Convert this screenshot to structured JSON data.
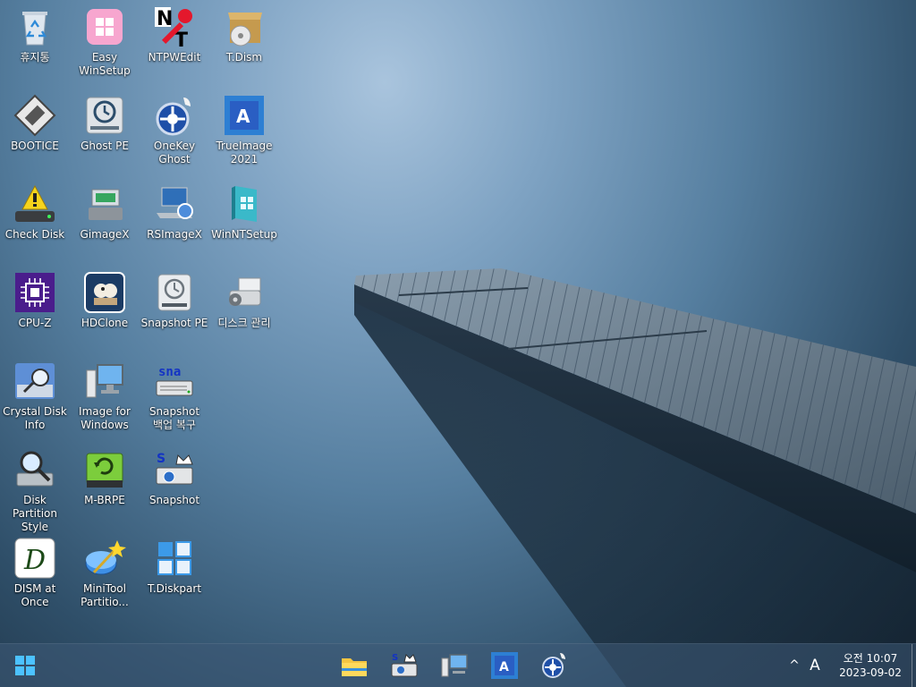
{
  "desktop_icons": [
    {
      "label": "휴지통",
      "icon": "recycle-bin-icon"
    },
    {
      "label": "Easy\nWinSetup",
      "icon": "easy-winsetup-icon"
    },
    {
      "label": "NTPWEdit",
      "icon": "ntpwedit-icon"
    },
    {
      "label": "T.Dism",
      "icon": "tdism-icon"
    },
    {
      "label": "BOOTICE",
      "icon": "bootice-icon"
    },
    {
      "label": "Ghost PE",
      "icon": "ghost-pe-icon"
    },
    {
      "label": "OneKey\nGhost",
      "icon": "onekey-ghost-icon"
    },
    {
      "label": "TrueImage\n2021",
      "icon": "trueimage-icon"
    },
    {
      "label": "Check Disk",
      "icon": "check-disk-icon"
    },
    {
      "label": "GimageX",
      "icon": "gimagex-icon"
    },
    {
      "label": "RSImageX",
      "icon": "rsimagex-icon"
    },
    {
      "label": "WinNTSetup",
      "icon": "winntsetup-icon"
    },
    {
      "label": "CPU-Z",
      "icon": "cpu-z-icon"
    },
    {
      "label": "HDClone",
      "icon": "hdclone-icon"
    },
    {
      "label": "Snapshot PE",
      "icon": "snapshot-pe-icon"
    },
    {
      "label": "디스크 관리",
      "icon": "disk-management-icon"
    },
    {
      "label": "Crystal Disk\nInfo",
      "icon": "crystal-disk-info-icon"
    },
    {
      "label": "Image for\nWindows",
      "icon": "image-for-windows-icon"
    },
    {
      "label": "Snapshot\n백업 복구",
      "icon": "snapshot-restore-icon"
    },
    {
      "label": "Disk Partition\nStyle",
      "icon": "disk-partition-style-icon"
    },
    {
      "label": "M-BRPE",
      "icon": "m-brpe-icon"
    },
    {
      "label": "Snapshot",
      "icon": "snapshot-icon"
    },
    {
      "label": "DISM at\nOnce",
      "icon": "dism-at-once-icon"
    },
    {
      "label": "MiniTool\nPartitio...",
      "icon": "minitool-partition-icon"
    },
    {
      "label": "T.Diskpart",
      "icon": "tdiskpart-icon"
    }
  ],
  "taskbar": {
    "start_icon": "windows-logo-icon",
    "pinned": [
      {
        "icon": "file-explorer-icon"
      },
      {
        "icon": "snapshot-icon"
      },
      {
        "icon": "image-for-windows-icon"
      },
      {
        "icon": "trueimage-icon"
      },
      {
        "icon": "onekey-ghost-icon"
      }
    ],
    "tray": {
      "chevron": "^",
      "ime": "A",
      "time": "오전 10:07",
      "date": "2023-09-02"
    }
  },
  "colors": {
    "accent_blue": "#2d7fd3",
    "taskbar": "#3e5a76"
  }
}
